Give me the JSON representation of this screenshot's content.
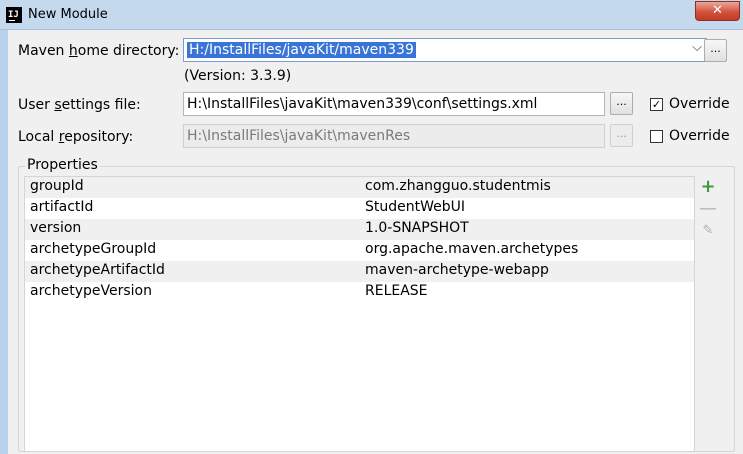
{
  "window": {
    "title": "New Module",
    "icon": "intellij-icon",
    "close_glyph": "✕"
  },
  "maven_home": {
    "label_pre": "Maven ",
    "label_mn": "h",
    "label_post": "ome directory:",
    "value": "H:/InstallFiles/javaKit/maven339",
    "arrow": "⌵",
    "browse": "...",
    "version": "(Version: 3.3.9)"
  },
  "user_settings": {
    "label_pre": "User ",
    "label_mn": "s",
    "label_post": "ettings file:",
    "value": "H:\\InstallFiles\\javaKit\\maven339\\conf\\settings.xml",
    "browse": "...",
    "override_label": "Override",
    "override_checked": true,
    "check_glyph": "✓"
  },
  "local_repo": {
    "label_pre": "Local ",
    "label_mn": "r",
    "label_post": "epository:",
    "value": "H:\\InstallFiles\\javaKit\\mavenRes",
    "browse": "...",
    "override_label": "Override",
    "override_checked": false
  },
  "properties": {
    "title": "Properties",
    "rows": [
      {
        "key": "groupId",
        "value": "com.zhangguo.studentmis"
      },
      {
        "key": "artifactId",
        "value": "StudentWebUI"
      },
      {
        "key": "version",
        "value": "1.0-SNAPSHOT"
      },
      {
        "key": "archetypeGroupId",
        "value": "org.apache.maven.archetypes"
      },
      {
        "key": "archetypeArtifactId",
        "value": "maven-archetype-webapp"
      },
      {
        "key": "archetypeVersion",
        "value": "RELEASE"
      }
    ],
    "toolbar": {
      "add_glyph": "+",
      "remove_glyph": "—",
      "edit_glyph": "✎"
    }
  }
}
